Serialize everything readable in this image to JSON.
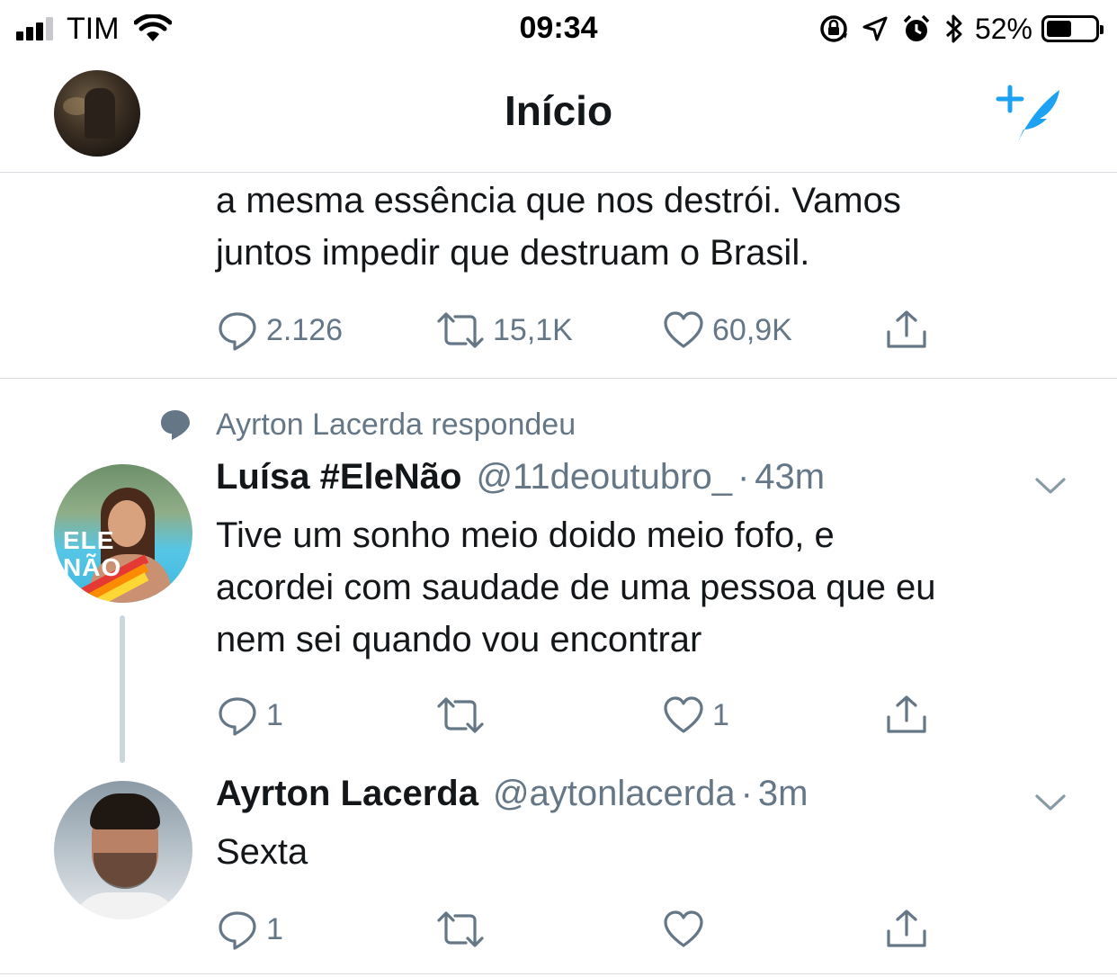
{
  "status_bar": {
    "carrier": "TIM",
    "time": "09:34",
    "battery_percent": "52%",
    "battery_level": 0.52,
    "icons": [
      "signal-icon",
      "wifi-icon",
      "orientation-lock-icon",
      "location-icon",
      "alarm-icon",
      "bluetooth-icon",
      "battery-icon"
    ]
  },
  "nav": {
    "title": "Início",
    "compose_icon": "compose-tweet-icon",
    "accent_color": "#1da1f2"
  },
  "tweets": [
    {
      "text": "a mesma essência que nos destrói. Vamos juntos impedir que destruam o Brasil.",
      "lines": [
        "a mesma essência que nos destrói. Vamos",
        "juntos impedir que destruam o Brasil."
      ],
      "replies": "2.126",
      "retweets": "15,1K",
      "likes": "60,9K"
    },
    {
      "social_context": "Ayrton Lacerda respondeu",
      "name": "Luísa #EleNão",
      "handle": "@11deoutubro_",
      "separator": "·",
      "time": "43m",
      "lines": [
        "Tive um sonho meio doido meio fofo, e",
        "acordei com saudade de uma pessoa que eu",
        "nem sei quando vou encontrar"
      ],
      "replies": "1",
      "retweets": "",
      "likes": "1",
      "avatar_text": [
        "ELE",
        "NÃO"
      ]
    },
    {
      "name": "Ayrton Lacerda",
      "handle": "@aytonlacerda",
      "separator": "·",
      "time": "3m",
      "lines": [
        "Sexta"
      ],
      "replies": "1",
      "retweets": "",
      "likes": ""
    }
  ]
}
